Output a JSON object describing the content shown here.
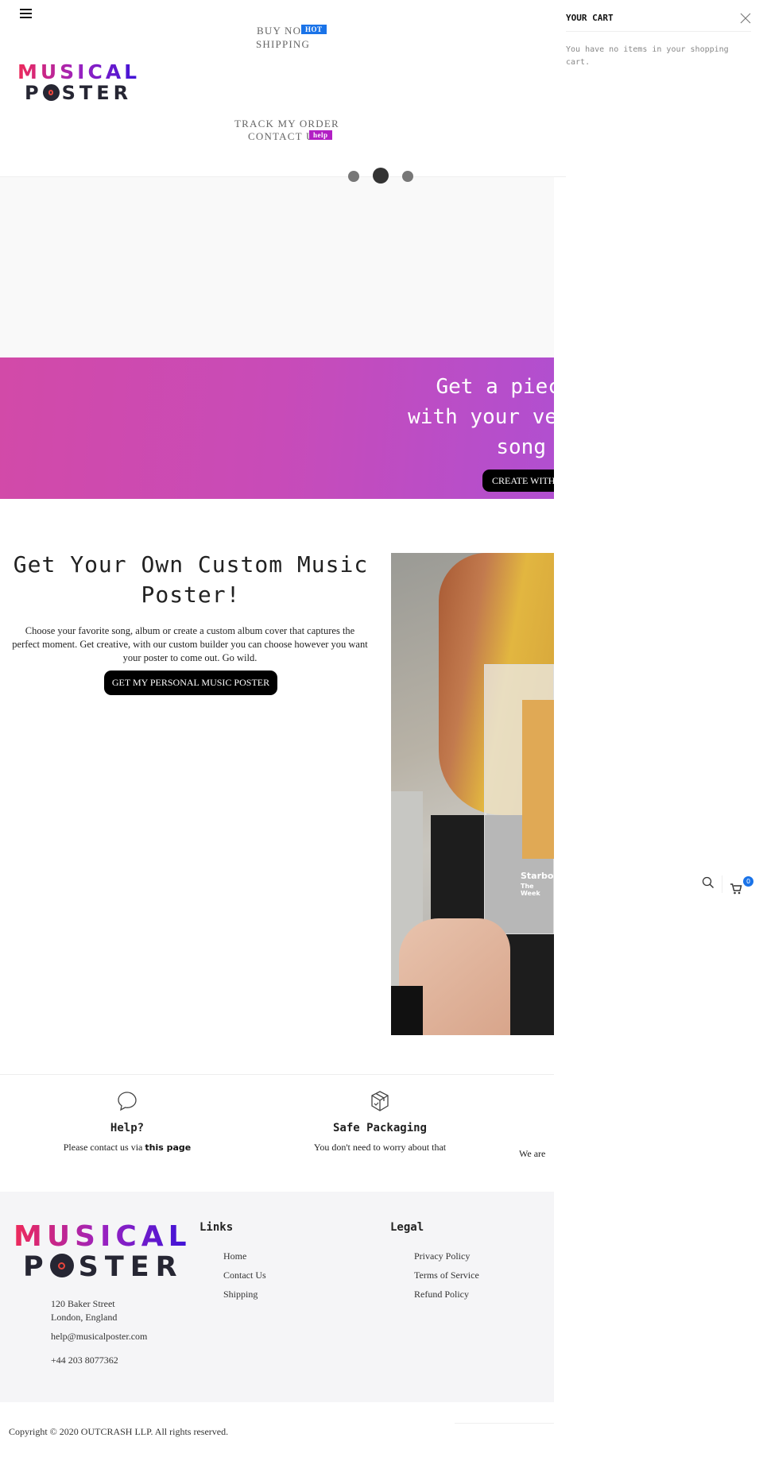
{
  "header": {
    "menu_icon": "hamburger-icon",
    "nav": [
      {
        "label": "BUY NOW",
        "badge": "HOT",
        "badge_color": "#1a73e8"
      },
      {
        "label": "SHIPPING"
      },
      {
        "label": "TRACK MY ORDER"
      },
      {
        "label": "CONTACT US",
        "badge": "help",
        "badge_color": "#b21fc4"
      }
    ],
    "logo": {
      "line1": "MUSICAL",
      "line2_a": "P",
      "line2_b": "STER"
    }
  },
  "cart": {
    "title": "YOUR CART",
    "empty_message": "You have no items in your shopping cart.",
    "close_icon": "close-icon"
  },
  "slider": {
    "dots": 3,
    "active": 1
  },
  "banner": {
    "heading_lines": [
      "Get a piec",
      "with your ve",
      "song"
    ],
    "button": "CREATE WITH"
  },
  "promo": {
    "heading": "Get Your Own Custom Music Poster!",
    "body": "Choose your favorite song, album or create a custom album cover that captures the perfect moment. Get creative, with our custom builder you can choose however you want your poster to come out. Go wild.",
    "button": "GET MY PERSONAL MUSIC POSTER",
    "image_text": {
      "title": "Starbo",
      "artist": "The Week"
    }
  },
  "features": [
    {
      "icon": "chat-bubble-icon",
      "title": "Help?",
      "text": "Please contact us via ",
      "link": "this page"
    },
    {
      "icon": "package-box-icon",
      "title": "Safe Packaging",
      "text": "You don't need to worry about that"
    },
    {
      "text": "We are"
    }
  ],
  "floating": {
    "search_icon": "search-icon",
    "cart_icon": "cart-icon",
    "cart_count": "0",
    "badge_color": "#1a73e8"
  },
  "footer": {
    "address_lines": [
      "120 Baker Street",
      "London, England"
    ],
    "email": "help@musicalposter.com",
    "phone": "+44 203 8077362",
    "links_heading": "Links",
    "links": [
      "Home",
      "Contact Us",
      "Shipping"
    ],
    "legal_heading": "Legal",
    "legal": [
      "Privacy Policy",
      "Terms of Service",
      "Refund Policy"
    ],
    "copyright": "Copyright © 2020 OUTCRASH LLP. All rights reserved."
  }
}
